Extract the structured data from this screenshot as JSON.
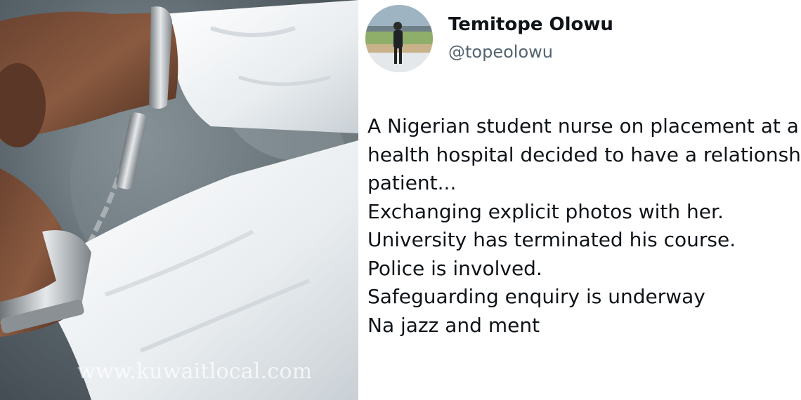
{
  "photo": {
    "watermark": "www.kuwaitlocal.com"
  },
  "tweet": {
    "author_name": "Temitope Olowu",
    "author_handle": "@topeolowu",
    "lines": [
      "A Nigerian student nurse on placement at a mental",
      "health hospital decided to have a relationship with a",
      "patient...",
      "Exchanging explicit photos with her.",
      "University has terminated his course.",
      "Police is involved.",
      "Safeguarding enquiry is underway",
      "Na jazz and ment"
    ]
  },
  "colors": {
    "text_primary": "#0f1419",
    "text_secondary": "#536471"
  }
}
